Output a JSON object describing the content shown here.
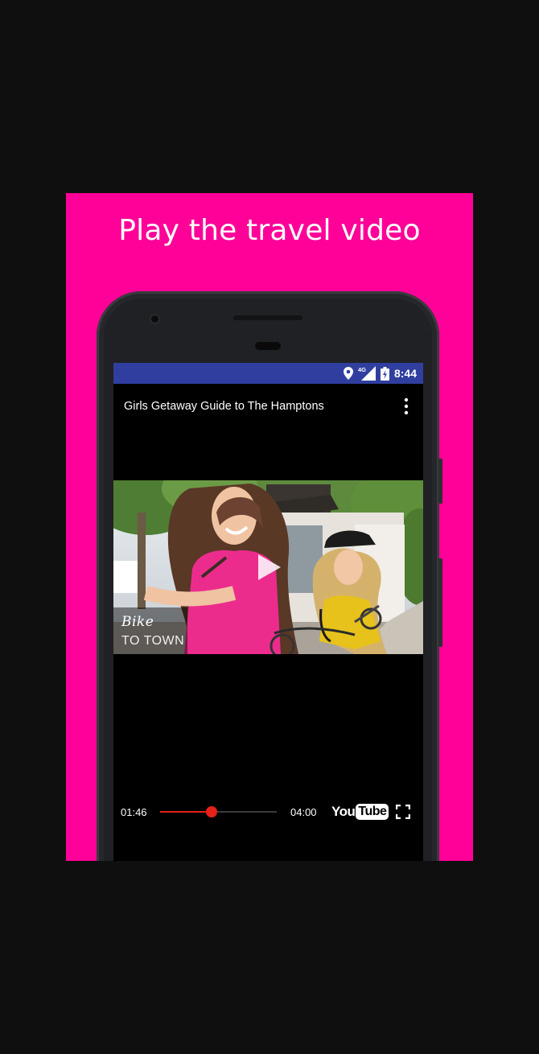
{
  "promo": {
    "title": "Play the travel video",
    "background": "#ff0098"
  },
  "status_bar": {
    "time": "8:44",
    "network_label": "4G",
    "icons": [
      "location-pin-icon",
      "signal-4g-icon",
      "battery-charging-icon"
    ],
    "background": "#303f9f"
  },
  "video": {
    "title": "Girls Getaway Guide to The Hamptons",
    "thumbnail_caption_script": "Bike",
    "thumbnail_caption": "TO TOWN"
  },
  "player": {
    "current_time": "01:46",
    "total_time": "04:00",
    "progress": 0.4417,
    "logo_you": "You",
    "logo_tube": "Tube",
    "accent": "#e62117"
  }
}
